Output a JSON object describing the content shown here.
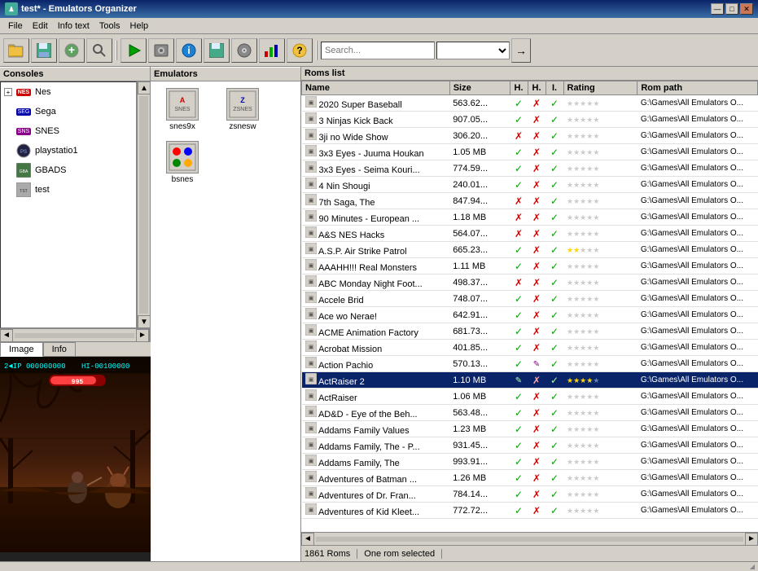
{
  "window": {
    "title": "test* - Emulators Organizer",
    "icon": "♟"
  },
  "titlebar_controls": {
    "minimize": "—",
    "maximize": "□",
    "close": "✕"
  },
  "menubar": {
    "items": [
      "File",
      "Edit",
      "Info text",
      "Tools",
      "Help"
    ]
  },
  "toolbar": {
    "buttons": [
      "📁",
      "💾",
      "➕",
      "🔍",
      "→",
      "▶",
      "💿",
      "ℹ",
      "💾",
      "💿",
      "❓"
    ]
  },
  "consoles": {
    "header": "Consoles",
    "items": [
      {
        "name": "Nes",
        "icon": "NES",
        "expanded": true
      },
      {
        "name": "Sega",
        "icon": "SEG"
      },
      {
        "name": "SNES",
        "icon": "SNS"
      },
      {
        "name": "playstatio1",
        "icon": "PS"
      },
      {
        "name": "GBADS",
        "icon": "GBA"
      },
      {
        "name": "test",
        "icon": "TST"
      }
    ]
  },
  "emulators": {
    "header": "Emulators",
    "items": [
      {
        "name": "snes9x",
        "icon": "A"
      },
      {
        "name": "zsnesw",
        "icon": "Z"
      },
      {
        "name": "bsnes",
        "icon": "B"
      }
    ]
  },
  "roms": {
    "header": "Roms list",
    "columns": [
      "Name",
      "Size",
      "H.",
      "H.",
      "I.",
      "Rating",
      "Rom path"
    ],
    "status": "1861 Roms",
    "selected_status": "One rom selected",
    "rows": [
      {
        "name": "2020 Super Baseball",
        "size": "563.62...",
        "h1": true,
        "h2": false,
        "i": true,
        "rating": 0,
        "path": "G:\\Games\\All  Emulators O..."
      },
      {
        "name": "3 Ninjas Kick Back",
        "size": "907.05...",
        "h1": true,
        "h2": false,
        "i": true,
        "rating": 0,
        "path": "G:\\Games\\All  Emulators O..."
      },
      {
        "name": "3ji no Wide Show",
        "size": "306.20...",
        "h1": false,
        "h2": false,
        "i": true,
        "rating": 0,
        "path": "G:\\Games\\All  Emulators O..."
      },
      {
        "name": "3x3 Eyes - Juuma Houkan",
        "size": "1.05 MB",
        "h1": true,
        "h2": false,
        "i": true,
        "rating": 0,
        "path": "G:\\Games\\All  Emulators O..."
      },
      {
        "name": "3x3 Eyes - Seima Kouri...",
        "size": "774.59...",
        "h1": true,
        "h2": false,
        "i": true,
        "rating": 0,
        "path": "G:\\Games\\All  Emulators O..."
      },
      {
        "name": "4 Nin Shougi",
        "size": "240.01...",
        "h1": true,
        "h2": false,
        "i": true,
        "rating": 0,
        "path": "G:\\Games\\All  Emulators O..."
      },
      {
        "name": "7th Saga, The",
        "size": "847.94...",
        "h1": false,
        "h2": false,
        "i": true,
        "rating": 0,
        "path": "G:\\Games\\All  Emulators O..."
      },
      {
        "name": "90 Minutes - European ...",
        "size": "1.18 MB",
        "h1": false,
        "h2": false,
        "i": true,
        "rating": 0,
        "path": "G:\\Games\\All  Emulators O..."
      },
      {
        "name": "A&S NES Hacks",
        "size": "564.07...",
        "h1": false,
        "h2": false,
        "i": true,
        "rating": 0,
        "path": "G:\\Games\\All  Emulators O..."
      },
      {
        "name": "A.S.P. Air Strike Patrol",
        "size": "665.23...",
        "h1": true,
        "h2": false,
        "i": true,
        "rating": 2,
        "path": "G:\\Games\\All  Emulators O..."
      },
      {
        "name": "AAAHH!!! Real Monsters",
        "size": "1.11 MB",
        "h1": true,
        "h2": false,
        "i": true,
        "rating": 0,
        "path": "G:\\Games\\All  Emulators O..."
      },
      {
        "name": "ABC Monday Night Foot...",
        "size": "498.37...",
        "h1": false,
        "h2": false,
        "i": true,
        "rating": 0,
        "path": "G:\\Games\\All  Emulators O..."
      },
      {
        "name": "Accele Brid",
        "size": "748.07...",
        "h1": true,
        "h2": false,
        "i": true,
        "rating": 0,
        "path": "G:\\Games\\All  Emulators O..."
      },
      {
        "name": "Ace wo Nerae!",
        "size": "642.91...",
        "h1": true,
        "h2": false,
        "i": true,
        "rating": 0,
        "path": "G:\\Games\\All  Emulators O..."
      },
      {
        "name": "ACME Animation Factory",
        "size": "681.73...",
        "h1": true,
        "h2": false,
        "i": true,
        "rating": 0,
        "path": "G:\\Games\\All  Emulators O..."
      },
      {
        "name": "Acrobat Mission",
        "size": "401.85...",
        "h1": true,
        "h2": false,
        "i": true,
        "rating": 0,
        "path": "G:\\Games\\All  Emulators O..."
      },
      {
        "name": "Action Pachio",
        "size": "570.13...",
        "h1": true,
        "h2": true,
        "i": true,
        "rating": 0,
        "path": "G:\\Games\\All  Emulators O..."
      },
      {
        "name": "ActRaiser 2",
        "size": "1.10 MB",
        "h1": true,
        "h2": false,
        "i": true,
        "rating": 4,
        "path": "G:\\Games\\All  Emulators O...",
        "selected": true
      },
      {
        "name": "ActRaiser",
        "size": "1.06 MB",
        "h1": true,
        "h2": false,
        "i": true,
        "rating": 0,
        "path": "G:\\Games\\All  Emulators O..."
      },
      {
        "name": "AD&D - Eye of the Beh...",
        "size": "563.48...",
        "h1": true,
        "h2": false,
        "i": true,
        "rating": 0,
        "path": "G:\\Games\\All  Emulators O..."
      },
      {
        "name": "Addams Family Values",
        "size": "1.23 MB",
        "h1": true,
        "h2": false,
        "i": true,
        "rating": 0,
        "path": "G:\\Games\\All  Emulators O..."
      },
      {
        "name": "Addams Family, The - P...",
        "size": "931.45...",
        "h1": true,
        "h2": false,
        "i": true,
        "rating": 0,
        "path": "G:\\Games\\All  Emulators O..."
      },
      {
        "name": "Addams Family, The",
        "size": "993.91...",
        "h1": true,
        "h2": false,
        "i": true,
        "rating": 0,
        "path": "G:\\Games\\All  Emulators O..."
      },
      {
        "name": "Adventures of Batman ...",
        "size": "1.26 MB",
        "h1": true,
        "h2": false,
        "i": true,
        "rating": 0,
        "path": "G:\\Games\\All  Emulators O..."
      },
      {
        "name": "Adventures of Dr. Fran...",
        "size": "784.14...",
        "h1": true,
        "h2": false,
        "i": true,
        "rating": 0,
        "path": "G:\\Games\\All  Emulators O..."
      },
      {
        "name": "Adventures of Kid Kleet...",
        "size": "772.72...",
        "h1": true,
        "h2": false,
        "i": true,
        "rating": 0,
        "path": "G:\\Games\\All  Emulators O..."
      }
    ]
  },
  "image_tabs": [
    "Image",
    "Info"
  ],
  "active_image_tab": "Image"
}
